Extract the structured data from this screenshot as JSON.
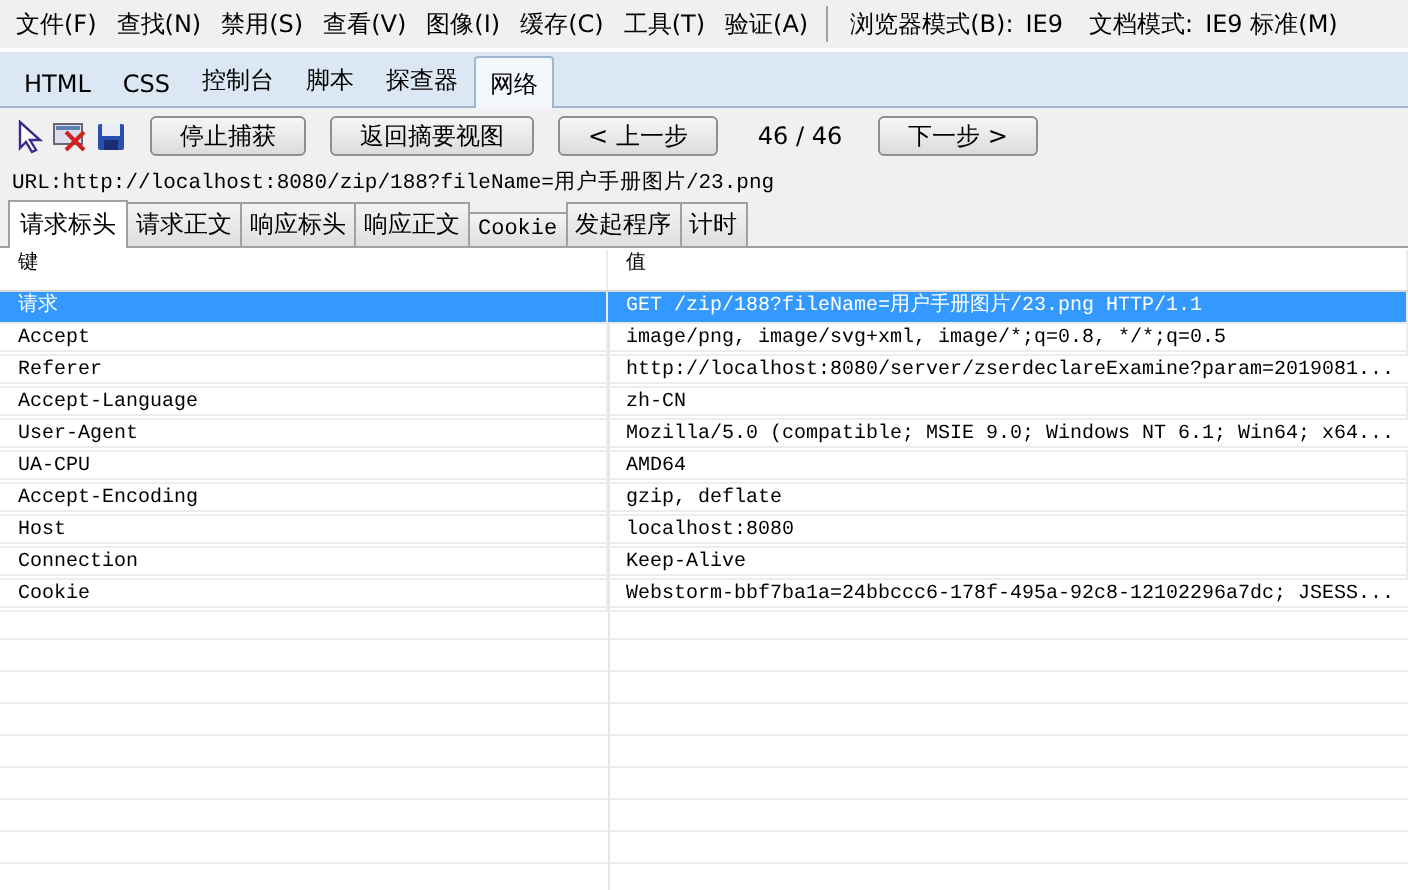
{
  "menu": [
    {
      "label": "文件(F)"
    },
    {
      "label": "查找(N)"
    },
    {
      "label": "禁用(S)"
    },
    {
      "label": "查看(V)"
    },
    {
      "label": "图像(I)"
    },
    {
      "label": "缓存(C)"
    },
    {
      "label": "工具(T)"
    },
    {
      "label": "验证(A)"
    }
  ],
  "modes": [
    {
      "label": "浏览器模式(B):",
      "value": "IE9"
    },
    {
      "label": "文档模式:",
      "value": "IE9 标准(M)"
    }
  ],
  "tabs": [
    {
      "label": "HTML",
      "selected": false
    },
    {
      "label": "CSS",
      "selected": false
    },
    {
      "label": "控制台",
      "selected": false
    },
    {
      "label": "脚本",
      "selected": false
    },
    {
      "label": "探查器",
      "selected": false
    },
    {
      "label": "网络",
      "selected": true
    }
  ],
  "toolbar": {
    "buttons": [
      "停止捕获",
      "返回摘要视图",
      "< 上一步"
    ],
    "counter": "46 / 46",
    "next": "下一步 >"
  },
  "url": "URL:http://localhost:8080/zip/188?fileName=用户手册图片/23.png",
  "subtabs": [
    {
      "label": "请求标头",
      "selected": true
    },
    {
      "label": "请求正文",
      "selected": false
    },
    {
      "label": "响应标头",
      "selected": false
    },
    {
      "label": "响应正文",
      "selected": false
    },
    {
      "label": "Cookie",
      "selected": false
    },
    {
      "label": "发起程序",
      "selected": false
    },
    {
      "label": "计时",
      "selected": false
    }
  ],
  "table": {
    "columns": [
      "键",
      "值"
    ],
    "rows": [
      {
        "key": "请求",
        "value": "GET /zip/188?fileName=用户手册图片/23.png HTTP/1.1",
        "selected": true
      },
      {
        "key": "Accept",
        "value": "image/png, image/svg+xml, image/*;q=0.8, */*;q=0.5",
        "selected": false
      },
      {
        "key": "Referer",
        "value": "http://localhost:8080/server/zserdeclareExamine?param=2019081...",
        "selected": false
      },
      {
        "key": "Accept-Language",
        "value": "zh-CN",
        "selected": false
      },
      {
        "key": "User-Agent",
        "value": "Mozilla/5.0 (compatible; MSIE 9.0; Windows NT 6.1; Win64; x64...",
        "selected": false
      },
      {
        "key": "UA-CPU",
        "value": "AMD64",
        "selected": false
      },
      {
        "key": "Accept-Encoding",
        "value": "gzip, deflate",
        "selected": false
      },
      {
        "key": "Host",
        "value": "localhost:8080",
        "selected": false
      },
      {
        "key": "Connection",
        "value": "Keep-Alive",
        "selected": false
      },
      {
        "key": "Cookie",
        "value": "Webstorm-bbf7ba1a=24bbccc6-178f-495a-92c8-12102296a7dc; JSESS...",
        "selected": false
      }
    ]
  }
}
